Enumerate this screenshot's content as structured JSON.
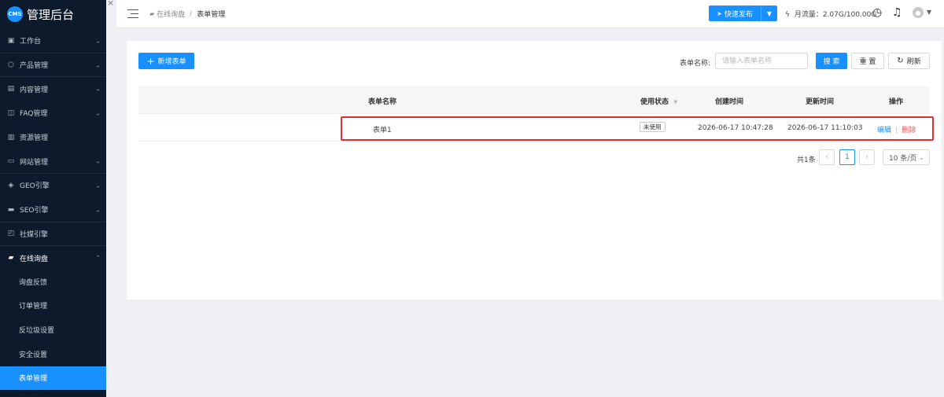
{
  "app": {
    "logo_badge": "CMS",
    "title": "管理后台"
  },
  "sidebar": {
    "items": [
      {
        "label": "工作台",
        "icon": "monitor-icon",
        "glyph": "▣",
        "chevron": "⌄"
      },
      {
        "label": "产品管理",
        "icon": "box-icon",
        "glyph": "⬡",
        "chevron": "⌄"
      },
      {
        "label": "内容管理",
        "icon": "document-icon",
        "glyph": "▤",
        "chevron": "⌄"
      },
      {
        "label": "FAQ管理",
        "icon": "chat-icon",
        "glyph": "◫",
        "chevron": "⌄"
      },
      {
        "label": "资源管理",
        "icon": "database-icon",
        "glyph": "▥",
        "chevron": ""
      },
      {
        "label": "网站管理",
        "icon": "browser-icon",
        "glyph": "▭",
        "chevron": "⌄"
      },
      {
        "label": "GEO引擎",
        "icon": "shield-icon",
        "glyph": "◈",
        "chevron": "⌄"
      },
      {
        "label": "SEO引擎",
        "icon": "screen-icon",
        "glyph": "▬",
        "chevron": "⌄"
      },
      {
        "label": "社媒引擎",
        "icon": "share-icon",
        "glyph": "◰",
        "chevron": ""
      },
      {
        "label": "在线询盘",
        "icon": "message-icon",
        "glyph": "▰",
        "chevron": "⌃"
      }
    ],
    "sub_items": [
      "询盘反馈",
      "订单管理",
      "反垃圾设置",
      "安全设置",
      "表单管理"
    ],
    "active_sub": "表单管理"
  },
  "header": {
    "breadcrumb_parent": "在线询盘",
    "breadcrumb_sep": "/",
    "breadcrumb_current": "表单管理",
    "quick_publish": "快速发布",
    "traffic_label": "月流量：2.07G/100.00G",
    "close_glyph": "×"
  },
  "toolbar": {
    "new_form": "新增表单",
    "search_label": "表单名称:",
    "search_placeholder": "请输入表单名称",
    "search_btn": "搜 索",
    "reset_btn": "重 置",
    "refresh_btn": "刷新"
  },
  "table": {
    "columns": [
      "表单名称",
      "使用状态",
      "创建时间",
      "更新时间",
      "操作"
    ],
    "rows": [
      {
        "name": "表单1",
        "status": "未使用",
        "created": "2026-06-17 10:47:28",
        "updated": "2026-06-17 11:10:03",
        "edit": "编辑",
        "delete": "删除"
      }
    ]
  },
  "pagination": {
    "total": "共1条",
    "current_page": "1",
    "page_size": "10 条/页"
  },
  "colors": {
    "primary": "#1890ff",
    "sidebar_bg": "#0c1a2b",
    "danger": "#ff4d4f",
    "highlight": "#e03030"
  }
}
